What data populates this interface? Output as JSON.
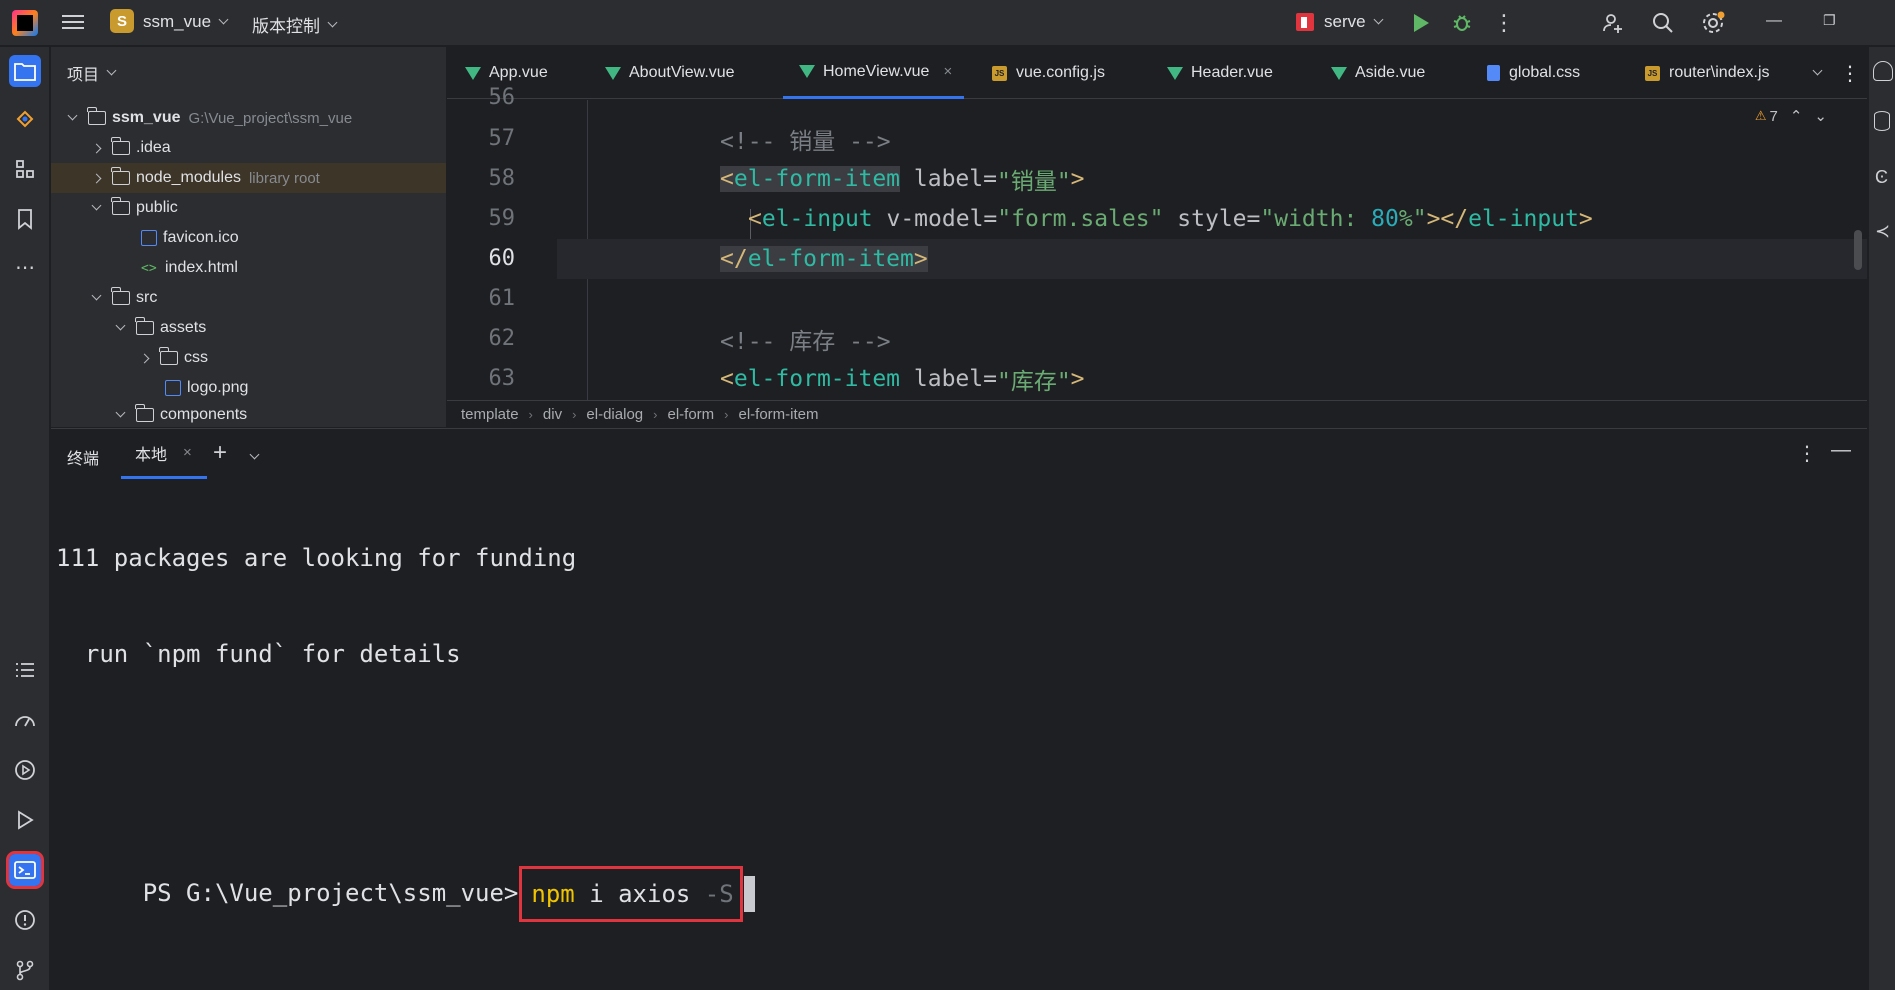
{
  "titlebar": {
    "project_badge": "S",
    "project_name": "ssm_vue",
    "vcs_label": "版本控制",
    "run_config": "serve"
  },
  "project_panel": {
    "title": "项目",
    "tree": [
      {
        "label": "ssm_vue",
        "hint": "G:\\Vue_project\\ssm_vue"
      },
      {
        "label": ".idea"
      },
      {
        "label": "node_modules",
        "hint": "library root"
      },
      {
        "label": "public"
      },
      {
        "label": "favicon.ico"
      },
      {
        "label": "index.html"
      },
      {
        "label": "src"
      },
      {
        "label": "assets"
      },
      {
        "label": "css"
      },
      {
        "label": "logo.png"
      },
      {
        "label": "components"
      }
    ]
  },
  "editor": {
    "tabs": [
      {
        "label": "App.vue",
        "icon": "vue-icon"
      },
      {
        "label": "AboutView.vue",
        "icon": "vue-icon"
      },
      {
        "label": "HomeView.vue",
        "icon": "vue-icon",
        "active": true
      },
      {
        "label": "vue.config.js",
        "icon": "js-icon"
      },
      {
        "label": "Header.vue",
        "icon": "vue-icon"
      },
      {
        "label": "Aside.vue",
        "icon": "vue-icon"
      },
      {
        "label": "global.css",
        "icon": "css-icon"
      },
      {
        "label": "router\\index.js",
        "icon": "js-icon"
      }
    ],
    "warnings": "7",
    "line_numbers": [
      "56",
      "57",
      "58",
      "59",
      "60",
      "61",
      "62",
      "63"
    ],
    "current_line": "60",
    "lines": {
      "l57": {
        "comment": "<!-- 销量 -->"
      },
      "l58": {
        "lt": "<",
        "tag": "el-form-item",
        "attr": " label=",
        "str": "\"销量\"",
        "gt": ">"
      },
      "l59": {
        "lt": "<",
        "tag": "el-input",
        "attr1": " v-model=",
        "str1": "\"form.sales\"",
        "attr2": " style=",
        "str2a": "\"width: ",
        "num": "80",
        "str2b": "%\"",
        "mid": "></",
        "tag2": "el-input",
        "gt": ">"
      },
      "l60": {
        "lt": "</",
        "tag": "el-form-item",
        "gt": ">"
      },
      "l62": {
        "comment": "<!-- 库存 -->"
      },
      "l63": {
        "lt": "<",
        "tag": "el-form-item",
        "attr": " label=",
        "str": "\"库存\"",
        "gt": ">"
      }
    },
    "breadcrumb": [
      "template",
      "div",
      "el-dialog",
      "el-form",
      "el-form-item"
    ]
  },
  "terminal": {
    "title": "终端",
    "tab": "本地",
    "lines": [
      "111 packages are looking for funding",
      "  run `npm fund` for details"
    ],
    "prompt": "PS G:\\Vue_project\\ssm_vue>",
    "cmd_npm": "npm",
    "cmd_rest": " i axios ",
    "cmd_flag": "-S"
  },
  "colors": {
    "accent": "#3574f0",
    "highlight_box": "#e0353f",
    "vue_green": "#41b883"
  }
}
